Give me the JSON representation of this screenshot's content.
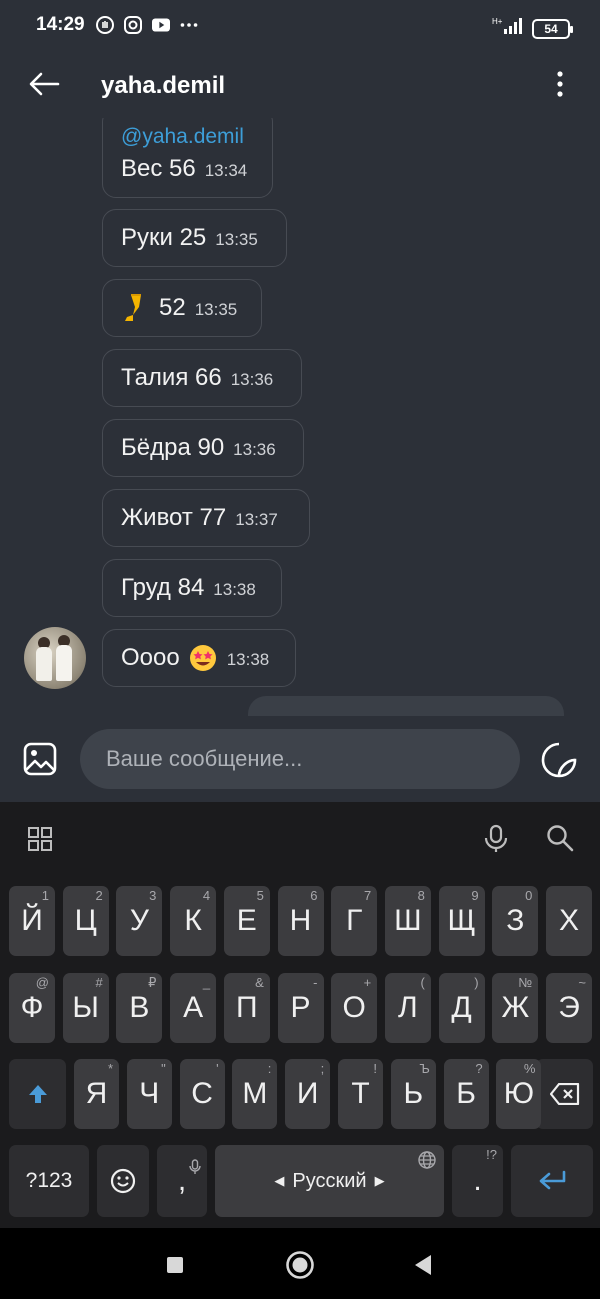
{
  "status_bar": {
    "time": "14:29",
    "battery": "54",
    "left_icons": [
      "hand-icon",
      "instagram-icon",
      "youtube-icon",
      "more-dots-icon"
    ],
    "right_icons": [
      "signal-icon",
      "battery-icon"
    ]
  },
  "header": {
    "title": "yaha.demil",
    "back_icon": "arrow-left-icon",
    "menu_icon": "vertical-dots-icon"
  },
  "messages": [
    {
      "mention": "@yaha.demil",
      "text": "Вес 56",
      "time": "13:34"
    },
    {
      "text": "Руки 25",
      "time": "13:35"
    },
    {
      "emoji": "leg-emoji",
      "text": "52",
      "time": "13:35"
    },
    {
      "text": "Талия 66",
      "time": "13:36"
    },
    {
      "text": "Бёдра 90",
      "time": "13:36"
    },
    {
      "text": "Живот 77",
      "time": "13:37"
    },
    {
      "text": "Груд 84",
      "time": "13:38"
    },
    {
      "text": "Оооо",
      "emoji": "star-struck-emoji",
      "time": "13:38"
    }
  ],
  "composer": {
    "placeholder": "Ваше сообщение...",
    "gallery_icon": "image-icon",
    "sticker_icon": "sticker-icon"
  },
  "keyboard": {
    "row1": [
      {
        "k": "Й",
        "h": "1"
      },
      {
        "k": "Ц",
        "h": "2"
      },
      {
        "k": "У",
        "h": "3"
      },
      {
        "k": "К",
        "h": "4"
      },
      {
        "k": "Е",
        "h": "5"
      },
      {
        "k": "Н",
        "h": "6"
      },
      {
        "k": "Г",
        "h": "7"
      },
      {
        "k": "Ш",
        "h": "8"
      },
      {
        "k": "Щ",
        "h": "9"
      },
      {
        "k": "З",
        "h": "0"
      },
      {
        "k": "Х",
        "h": ""
      }
    ],
    "row2": [
      {
        "k": "Ф",
        "h": "@"
      },
      {
        "k": "Ы",
        "h": "#"
      },
      {
        "k": "В",
        "h": "₽"
      },
      {
        "k": "А",
        "h": "_"
      },
      {
        "k": "П",
        "h": "&"
      },
      {
        "k": "Р",
        "h": "-"
      },
      {
        "k": "О",
        "h": "+"
      },
      {
        "k": "Л",
        "h": "("
      },
      {
        "k": "Д",
        "h": ")"
      },
      {
        "k": "Ж",
        "h": "№"
      },
      {
        "k": "Э",
        "h": "~"
      }
    ],
    "row3": [
      {
        "k": "Я",
        "h": "*"
      },
      {
        "k": "Ч",
        "h": "\""
      },
      {
        "k": "С",
        "h": "'"
      },
      {
        "k": "М",
        "h": ":"
      },
      {
        "k": "И",
        "h": ";"
      },
      {
        "k": "Т",
        "h": "!"
      },
      {
        "k": "Ь",
        "h": "Ъ"
      },
      {
        "k": "Б",
        "h": "?"
      },
      {
        "k": "Ю",
        "h": "%"
      }
    ],
    "symbols_label": "?123",
    "comma": ",",
    "language_label": "Русский",
    "period": ".",
    "period_hint": "!?",
    "shift_icon": "shift-arrow-icon",
    "backspace_icon": "backspace-icon",
    "enter_icon": "enter-icon"
  },
  "nav_bar": {
    "icons": [
      "recents-square-icon",
      "home-circle-icon",
      "back-triangle-icon"
    ]
  }
}
